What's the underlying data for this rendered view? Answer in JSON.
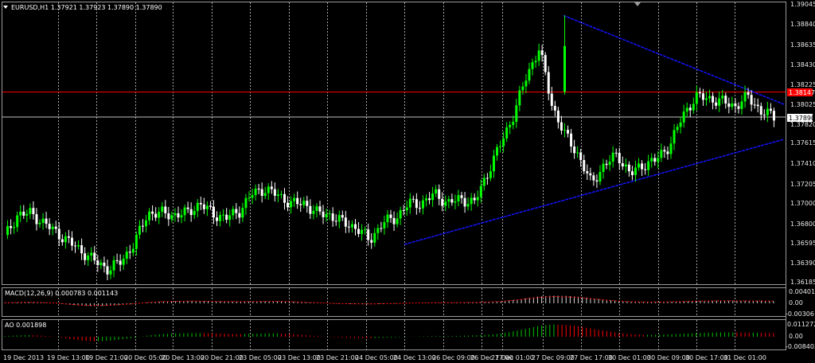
{
  "window": {
    "main_title": "EURUSD,H1  1.37921 1.37923 1.37890 1.37890",
    "macd_title": "MACD(12,26,9) 0.000783 0.001143",
    "ao_title": "AO 0.001898"
  },
  "colors": {
    "background": "#000000",
    "grid": "#cfcfcf",
    "bull_candle": "#00ff00",
    "bear_candle": "#ffffff",
    "red_line": "#ff0000",
    "trend_line": "#1414ff",
    "bid_line": "#c0c0c0",
    "macd_signal": "#ff0000",
    "ao_up": "#00c000",
    "ao_down": "#ff0000"
  },
  "price_axis": {
    "ticks": [
      "1.39045",
      "1.38840",
      "1.38635",
      "1.38430",
      "1.38225",
      "1.38025",
      "1.37820",
      "1.37615",
      "1.37410",
      "1.37205",
      "1.37000",
      "1.36800",
      "1.36595",
      "1.36390",
      "1.36185"
    ],
    "resistance_label": "1.38147",
    "bid_label": "1.37890",
    "ymin": 1.36185,
    "ymax": 1.39045
  },
  "macd_axis": {
    "ticks": [
      "0.00401",
      "0.00",
      "-0.003061"
    ]
  },
  "ao_axis": {
    "ticks": [
      "0.011272",
      "0.00",
      "-0.008403"
    ]
  },
  "time_axis": {
    "labels": [
      "19 Dec 2013",
      "19 Dec 13:00",
      "19 Dec 21:00",
      "20 Dec 05:00",
      "20 Dec 13:00",
      "20 Dec 21:00",
      "23 Dec 05:00",
      "23 Dec 13:00",
      "23 Dec 21:00",
      "24 Dec 05:00",
      "24 Dec 13:00",
      "26 Dec 09:00",
      "26 Dec 17:00",
      "27 Dec 01:00",
      "27 Dec 09:00",
      "27 Dec 17:00",
      "30 Dec 01:00",
      "30 Dec 09:00",
      "30 Dec 17:00",
      "31 Dec 01:00"
    ]
  },
  "chart_data": {
    "type": "candlestick",
    "symbol": "EURUSD",
    "timeframe": "H1",
    "last_bid": 1.3789,
    "resistance_level": 1.38147,
    "trendline_upper": {
      "from": 1.38935,
      "to": 1.3802
    },
    "trendline_lower": {
      "from": 1.36578,
      "to": 1.3766
    },
    "key_prices": [
      1.3665,
      1.3688,
      1.369,
      1.368,
      1.367,
      1.366,
      1.365,
      1.364,
      1.3632,
      1.3641,
      1.366,
      1.369,
      1.369,
      1.3688,
      1.369,
      1.37,
      1.3689,
      1.3685,
      1.3692,
      1.371,
      1.3715,
      1.3708,
      1.37,
      1.37,
      1.369,
      1.3688,
      1.368,
      1.3675,
      1.3662,
      1.368,
      1.3685,
      1.37,
      1.37,
      1.371,
      1.37,
      1.3705,
      1.37,
      1.373,
      1.376,
      1.379,
      1.383,
      1.386,
      1.38,
      1.377,
      1.375,
      1.372,
      1.374,
      1.375,
      1.373,
      1.374,
      1.3745,
      1.376,
      1.379,
      1.381,
      1.3808,
      1.3805,
      1.38,
      1.381,
      1.3795,
      1.3789
    ],
    "macd_signal": [
      0.0002,
      0.0004,
      0.0005,
      0.0003,
      0.0,
      -0.0007,
      -0.0012,
      -0.0014,
      -0.0012,
      -0.0008,
      -0.0003,
      0.0004,
      0.0008,
      0.001,
      0.0011,
      0.0011,
      0.001,
      0.0009,
      0.0008,
      0.0009,
      0.001,
      0.001,
      0.0008,
      0.0005,
      0.0002,
      -0.0001,
      -0.0003,
      -0.0004,
      -0.0005,
      -0.0003,
      -0.0002,
      0.0,
      0.0001,
      0.0002,
      0.0002,
      0.0003,
      0.0004,
      0.0006,
      0.0009,
      0.0016,
      0.0024,
      0.0033,
      0.0037,
      0.0036,
      0.0032,
      0.0025,
      0.0018,
      0.0012,
      0.0008,
      0.0006,
      0.0006,
      0.0007,
      0.0009,
      0.0011,
      0.0012,
      0.0013,
      0.0013,
      0.0012,
      0.0012,
      0.0011
    ]
  }
}
